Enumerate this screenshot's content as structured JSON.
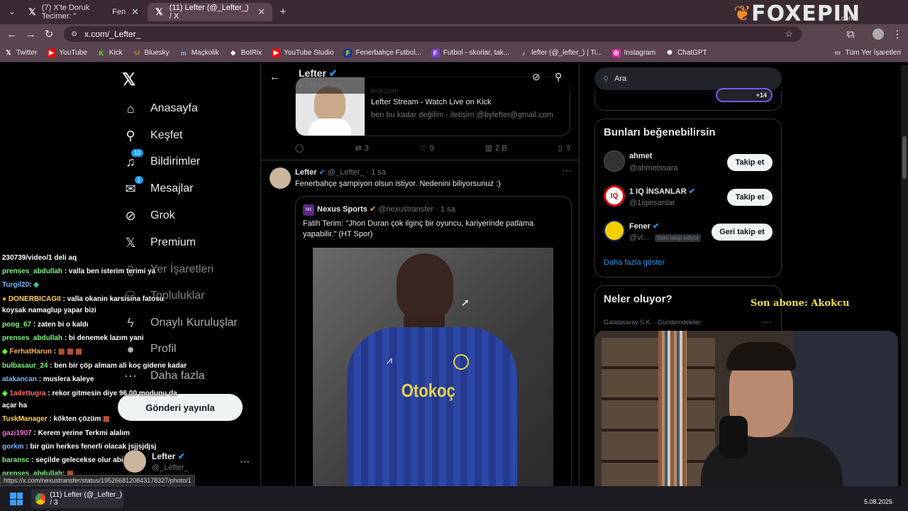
{
  "browser": {
    "tabs": [
      {
        "title": "(7) X'te Doruk Tecimer: \"",
        "suffix": "Fen"
      },
      {
        "title": "(11) Lefter (@_Lefter_) / X"
      }
    ],
    "url": "x.com/_Lefter_",
    "bookmarks": [
      {
        "label": "Twitter"
      },
      {
        "label": "YouTube"
      },
      {
        "label": "Kick"
      },
      {
        "label": "Bluesky"
      },
      {
        "label": "Maçkolik"
      },
      {
        "label": "BotRix"
      },
      {
        "label": "YouTube Studio"
      },
      {
        "label": "Fenerbahçe Futbol..."
      },
      {
        "label": "Futbol - skorlar, tak..."
      },
      {
        "label": "lefter (@_lefter_) | Ti..."
      },
      {
        "label": "Instagram"
      },
      {
        "label": "ChatGPT"
      }
    ],
    "all_bookmarks": "Tüm Yer İşaretleri",
    "status_url": "https://x.com/nexustransfer/status/1952668120843178327/photo/1"
  },
  "overlay_brand": "FOXEPIN",
  "overlay_brand_sub": ".com",
  "sidebar": {
    "items": [
      {
        "label": "Anasayfa",
        "icon": "home-icon"
      },
      {
        "label": "Keşfet",
        "icon": "search-icon"
      },
      {
        "label": "Bildirimler",
        "icon": "bell-icon",
        "badge": "10"
      },
      {
        "label": "Mesajlar",
        "icon": "mail-icon",
        "badge": "1"
      },
      {
        "label": "Grok",
        "icon": "grok-icon"
      },
      {
        "label": "Premium",
        "icon": "x-icon"
      },
      {
        "label": "Yer İşaretleri",
        "icon": "bookmark-icon"
      },
      {
        "label": "Topluluklar",
        "icon": "communities-icon"
      },
      {
        "label": "Onaylı Kuruluşlar",
        "icon": "lightning-icon"
      },
      {
        "label": "Profil",
        "icon": "person-icon"
      },
      {
        "label": "Daha fazla",
        "icon": "more-icon"
      }
    ],
    "post_button": "Gönderi yayınla",
    "account": {
      "name": "Lefter",
      "handle": "@_Lefter_"
    }
  },
  "profile_header": {
    "name": "Lefter",
    "posts": "5.252 gönderi"
  },
  "prev_card": {
    "title": "Lefter Stream - Watch Live on Kick",
    "desc": "ben bu kadar değilim - iletişim @bylefter@gmail.com",
    "domain": "kick.com"
  },
  "prev_actions": {
    "retweets": "3",
    "likes": "9",
    "views": "2 B"
  },
  "tweet": {
    "name": "Lefter",
    "handle": "@_Lefter_",
    "time": "· 1 sa",
    "text": "Fenerbahçe şampiyon olsun istiyor. Nedenini biliyorsunuz :)",
    "quote": {
      "name": "Nexus Sports",
      "handle": "@nexustransfer",
      "time": "· 1 sa",
      "text": "Fatih Terim: \"Jhon Duran çok ilginç bir oyuncu, kariyerinde patlama yapabilir.\" (HT Spor)",
      "jersey_text": "Otokoç"
    }
  },
  "right": {
    "search_placeholder": "Ara",
    "trending_count": "+14",
    "suggest_title": "Bunları beğenebilirsin",
    "suggestions": [
      {
        "name": "ahmet",
        "handle": "@ahmetssara",
        "button": "Takip et"
      },
      {
        "name": "1 IQ İNSANLAR",
        "handle": "@1iqinsanlar",
        "button": "Takip et"
      },
      {
        "name": "Fener",
        "handle": "@vl...",
        "tag": "Seni takip ediyor",
        "button": "Geri takip et"
      }
    ],
    "show_more": "Daha fazla göster",
    "whats_happening": "Neler oluyor?",
    "trend_context": "Galatasaray S.K. · Gündemdekiler"
  },
  "stream_overlay": {
    "last_sub": "Son abone: Akokcu"
  },
  "chat": [
    {
      "user": "",
      "msg": "230739/video/1 deli aq",
      "color": "#ffffff"
    },
    {
      "user": "prenses_abdullah",
      "msg": ": valla ben isterim terimi ya",
      "color": "#7cf57c"
    },
    {
      "user": "Turgil20",
      "msg": ":",
      "color": "#7ab8ff"
    },
    {
      "user": "DONERBICAGII",
      "msg": ": valla okanin karsisina fatosu",
      "color": "#ffd34a"
    },
    {
      "user": "",
      "msg": "koysak namaglup yapar bizi",
      "color": "#ffffff"
    },
    {
      "user": "poog_67",
      "msg": ": zaten bi o kaldı",
      "color": "#7cf57c"
    },
    {
      "user": "prenses_abdullah",
      "msg": ": bi denemek lazım yani",
      "color": "#7cf57c"
    },
    {
      "user": "FerhatHarun",
      "msg": ":",
      "color": "#ffb347"
    },
    {
      "user": "bulbasaur_24",
      "msg": ": ben bir çöp almam ali koç gidene kadar",
      "color": "#7cf57c"
    },
    {
      "user": "atakancan",
      "msg": ": muslera kaleye",
      "color": "#7ab8ff"
    },
    {
      "user": "1adettugra",
      "msg": ": rekor gitmesin diye 96.00 modunu da",
      "color": "#ff6b6b"
    },
    {
      "user": "",
      "msg": "açar ha",
      "color": "#ffffff"
    },
    {
      "user": "TuskManager",
      "msg": ": kökten çözüm",
      "color": "#ffd34a"
    },
    {
      "user": "gazi1907",
      "msg": ": Kerem yerine Terkmi alalım",
      "color": "#ff6bd6"
    },
    {
      "user": "gorkm",
      "msg": ": bir gün herkes fenerli olacak jsjjsjdjsj",
      "color": "#7ab8ff"
    },
    {
      "user": "baransc",
      "msg": ": seçilde gelecekse olur abi",
      "color": "#7cf57c"
    },
    {
      "user": "prenses_abdullah",
      "msg": ":",
      "color": "#7cf57c"
    }
  ],
  "taskbar": {
    "app_title": "(11) Lefter (@_Lefter_) / 3",
    "date": "5.08.2025"
  }
}
